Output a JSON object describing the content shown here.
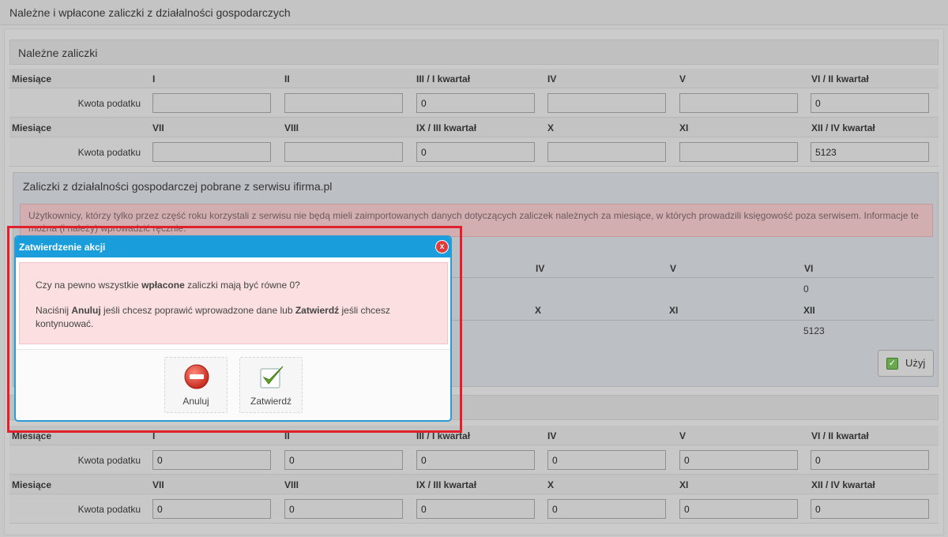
{
  "page": {
    "title": "Należne i wpłacone zaliczki z działalności gospodarczych"
  },
  "due": {
    "header": "Należne zaliczki",
    "row_label": "Miesiące",
    "amount_label": "Kwota podatku",
    "months_1": [
      "I",
      "II",
      "III / I kwartał",
      "IV",
      "V",
      "VI / II kwartał"
    ],
    "months_2": [
      "VII",
      "VIII",
      "IX / III kwartał",
      "X",
      "XI",
      "XII / IV kwartał"
    ],
    "values_1": [
      "",
      "",
      "0",
      "",
      "",
      "0"
    ],
    "values_2": [
      "",
      "",
      "0",
      "",
      "",
      "5123"
    ]
  },
  "import": {
    "title": "Zaliczki z działalności gospodarczej pobrane z serwisu ifirma.pl",
    "alert": "Użytkownicy, którzy tylko przez część roku korzystali z serwisu nie będą mieli zaimportowanych danych dotyczących zaliczek należnych za miesiące, w których prowadzili księgowość poza serwisem. Informacje te można (i należy) wprowadzić ręcznie.",
    "heads_1": [
      "IV",
      "V",
      "VI"
    ],
    "vals_1": [
      "0"
    ],
    "heads_2": [
      "X",
      "XI",
      "XII"
    ],
    "vals_2": [
      "5123"
    ],
    "use_button": "Użyj"
  },
  "paid": {
    "row_label": "Miesiące",
    "amount_label": "Kwota podatku",
    "months_1": [
      "I",
      "II",
      "III / I kwartał",
      "IV",
      "V",
      "VI / II kwartał"
    ],
    "months_2": [
      "VII",
      "VIII",
      "IX / III kwartał",
      "X",
      "XI",
      "XII / IV kwartał"
    ],
    "values_1": [
      "0",
      "0",
      "0",
      "0",
      "0",
      "0"
    ],
    "values_2": [
      "0",
      "0",
      "0",
      "0",
      "0",
      "0"
    ]
  },
  "modal": {
    "title": "Zatwierdzenie akcji",
    "close": "x",
    "line1_pre": "Czy na pewno wszystkie ",
    "line1_bold": "wpłacone",
    "line1_post": " zaliczki mają być równe 0?",
    "line2_pre": "Naciśnij ",
    "line2_bold1": "Anuluj",
    "line2_mid": " jeśli chcesz poprawić wprowadzone dane lub ",
    "line2_bold2": "Zatwierdź",
    "line2_post": " jeśli chcesz kontynuować.",
    "cancel": "Anuluj",
    "confirm": "Zatwierdź"
  }
}
